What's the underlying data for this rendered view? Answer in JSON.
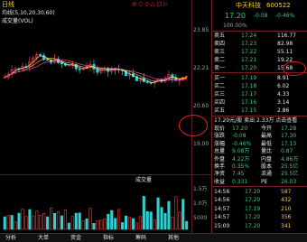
{
  "header": {
    "left_title": "日线",
    "indicator_line": "均线(5,10,20,30,60)",
    "sub_line": "成交量(VOL)",
    "right_icons": [
      "◎",
      "○",
      "◇",
      "△",
      "□",
      "▷"
    ]
  },
  "price_axis": [
    "23.85",
    "22.21",
    "20.60",
    "19.00"
  ],
  "volume_axis": [
    "1.5万",
    "1.0万",
    "5000"
  ],
  "volume_title": "成交量",
  "quote": {
    "price": "17.20",
    "change": "-0.08",
    "change_pct": "-0.46%",
    "stock_name": "中天科技",
    "stock_code": "600522",
    "top_label": "100.00%",
    "sell_rows": [
      {
        "label": "卖五",
        "price": "17.24",
        "vol": "116.77"
      },
      {
        "label": "卖四",
        "price": "17.23",
        "vol": "82.98"
      },
      {
        "label": "卖三",
        "price": "17.22",
        "vol": "55.11"
      },
      {
        "label": "卖二",
        "price": "17.21",
        "vol": "19.22"
      },
      {
        "label": "卖一",
        "price": "17.20",
        "vol": "15.68"
      }
    ],
    "buy_rows": [
      {
        "label": "买一",
        "price": "17.19",
        "vol": "8.91"
      },
      {
        "label": "买二",
        "price": "17.18",
        "vol": "6.02"
      },
      {
        "label": "买三",
        "price": "17.17",
        "vol": "4.33"
      },
      {
        "label": "买四",
        "price": "17.16",
        "vol": "3.14"
      },
      {
        "label": "买五",
        "price": "17.15",
        "vol": "2.86"
      }
    ],
    "stats_header": "17.20元/股 卖出 2.33万 点击查看",
    "stats": [
      {
        "label": "现价",
        "value": "17.20",
        "label2": "今开",
        "value2": "17.28"
      },
      {
        "label": "涨跌",
        "value": "-0.08",
        "label2": "最高",
        "value2": "17.30"
      },
      {
        "label": "涨幅",
        "value": "-0.46%",
        "label2": "最低",
        "value2": "17.13"
      },
      {
        "label": "总量",
        "value": "9.08万",
        "label2": "量比",
        "value2": "0.87"
      },
      {
        "label": "外盘",
        "value": "4.22万",
        "label2": "内盘",
        "value2": "4.86万"
      },
      {
        "label": "换手",
        "value": "0.35%",
        "label2": "股本",
        "value2": "25.5亿"
      },
      {
        "label": "净资",
        "value": "7.45",
        "label2": "流通",
        "value2": "25.5亿"
      },
      {
        "label": "收益",
        "value": "0.331",
        "label2": "PE",
        "value2": "26.03"
      }
    ],
    "ticks": [
      {
        "time": "14:56",
        "price": "17.20",
        "vol": "587"
      },
      {
        "time": "14:56",
        "price": "17.20",
        "vol": "432"
      },
      {
        "time": "14:57",
        "price": "17.19",
        "vol": "210"
      },
      {
        "time": "14:57",
        "price": "17.20",
        "vol": "356"
      },
      {
        "time": "15:00",
        "price": "17.20",
        "vol": "341"
      }
    ]
  },
  "bottom_tabs": [
    "分析",
    "大单",
    "资金",
    "指标",
    "筹码",
    "其他"
  ]
}
